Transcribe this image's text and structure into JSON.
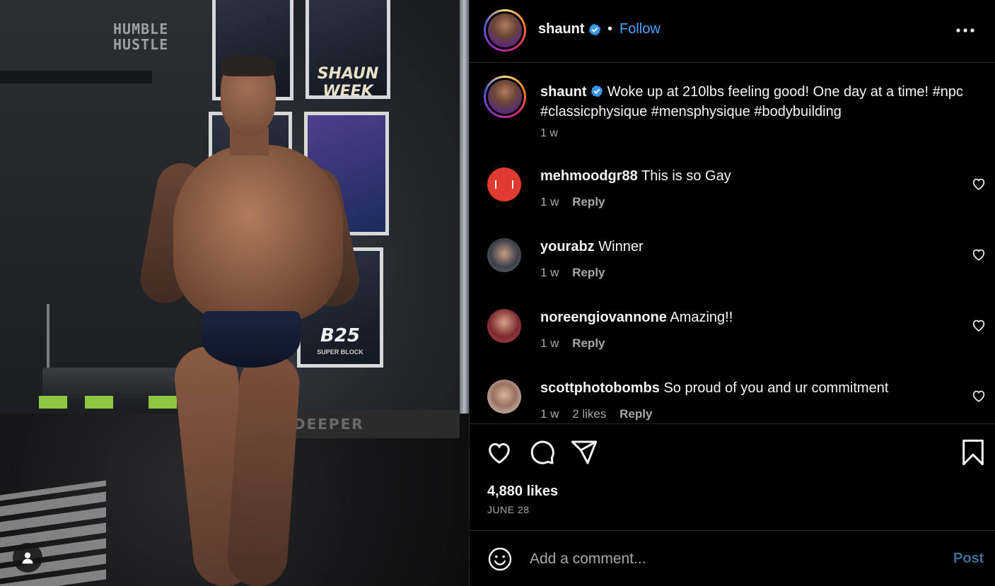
{
  "post": {
    "photo_alt": "",
    "wall_sign": "HUMBLE HUSTLE",
    "poster_labels": [
      "SHAUN WEEK",
      "B25"
    ],
    "poster_sub": "SUPER BLOCK",
    "mat_text": "DEEPER"
  },
  "header": {
    "username": "shaunt",
    "verified": true,
    "separator": "•",
    "follow_label": "Follow",
    "more_icon": "more-horizontal-icon"
  },
  "caption": {
    "username": "shaunt",
    "text": "Woke up at 210lbs feeling good! One day at a time! #npc #classicphysique #mensphysique #bodybuilding",
    "time": "1 w"
  },
  "comments": [
    {
      "username": "mehmoodgr88",
      "text": "This is so Gay",
      "time": "1 w",
      "likes": "",
      "reply": "Reply",
      "avatar_color": "#e03a32"
    },
    {
      "username": "yourabz",
      "text": "Winner",
      "time": "1 w",
      "likes": "",
      "reply": "Reply",
      "avatar_color": "#6b6f78"
    },
    {
      "username": "noreengiovannone",
      "text": "Amazing!!",
      "time": "1 w",
      "likes": "",
      "reply": "Reply",
      "avatar_color": "#c0405a"
    },
    {
      "username": "scottphotobombs",
      "text": "So proud of you and ur commitment",
      "time": "1 w",
      "likes": "2 likes",
      "reply": "Reply",
      "avatar_color": "#9a8a80"
    }
  ],
  "actions": {
    "like_icon": "heart-icon",
    "comment_icon": "comment-bubble-icon",
    "share_icon": "paper-plane-icon",
    "save_icon": "bookmark-icon"
  },
  "stats": {
    "likes": "4,880 likes",
    "date": "JUNE 28"
  },
  "composer": {
    "placeholder": "Add a comment...",
    "post_label": "Post",
    "emoji_icon": "emoji-smile-icon"
  },
  "colors": {
    "link_blue": "#4aa3ff",
    "post_disabled": "#3a6c97",
    "muted_text": "#a8a8a8",
    "verified_blue": "#3897f0"
  }
}
